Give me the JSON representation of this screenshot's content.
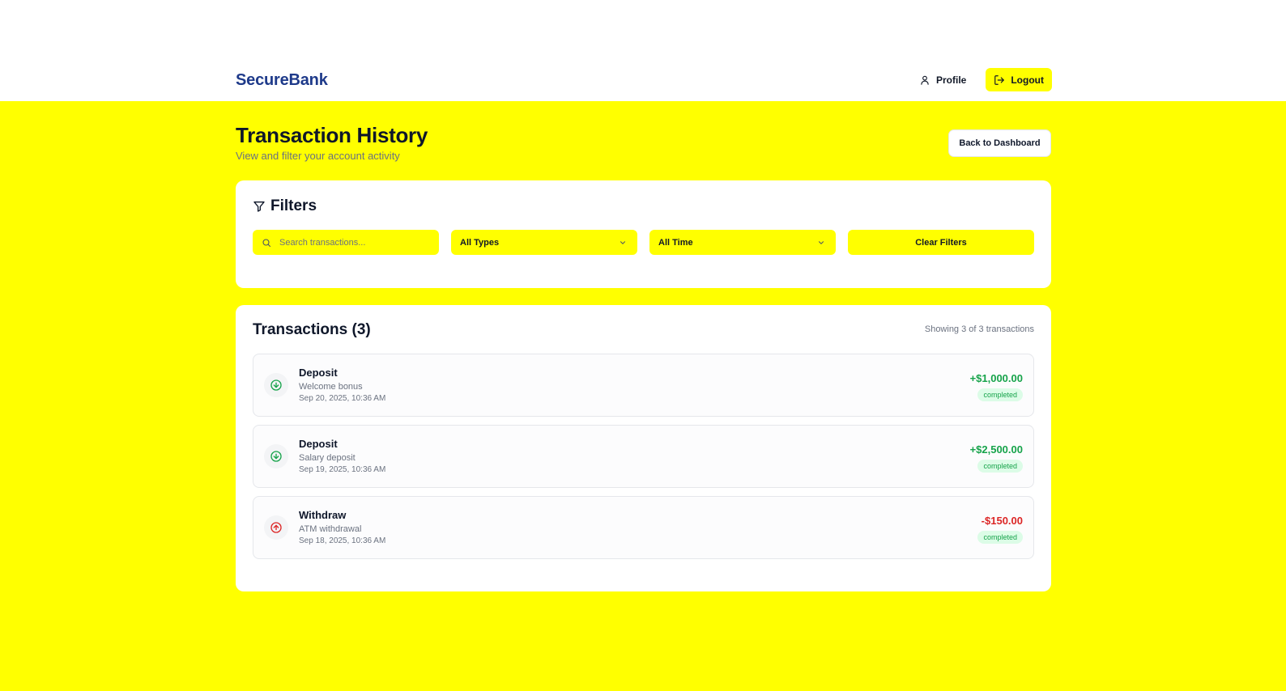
{
  "header": {
    "brand": "SecureBank",
    "profile_label": "Profile",
    "logout_label": "Logout"
  },
  "page": {
    "title": "Transaction History",
    "subtitle": "View and filter your account activity",
    "back_label": "Back to Dashboard"
  },
  "filters": {
    "title": "Filters",
    "search_placeholder": "Search transactions...",
    "type_value": "All Types",
    "time_value": "All Time",
    "clear_label": "Clear Filters"
  },
  "transactions": {
    "title": "Transactions (3)",
    "count_text": "Showing 3 of 3 transactions",
    "items": [
      {
        "type": "Deposit",
        "description": "Welcome bonus",
        "date": "Sep 20, 2025, 10:36 AM",
        "amount": "+$1,000.00",
        "status": "completed",
        "direction": "in"
      },
      {
        "type": "Deposit",
        "description": "Salary deposit",
        "date": "Sep 19, 2025, 10:36 AM",
        "amount": "+$2,500.00",
        "status": "completed",
        "direction": "in"
      },
      {
        "type": "Withdraw",
        "description": "ATM withdrawal",
        "date": "Sep 18, 2025, 10:36 AM",
        "amount": "-$150.00",
        "status": "completed",
        "direction": "out"
      }
    ]
  },
  "colors": {
    "background": "#ffff00",
    "brand": "#1e3a8a",
    "positive": "#16a34a",
    "negative": "#dc2626"
  }
}
